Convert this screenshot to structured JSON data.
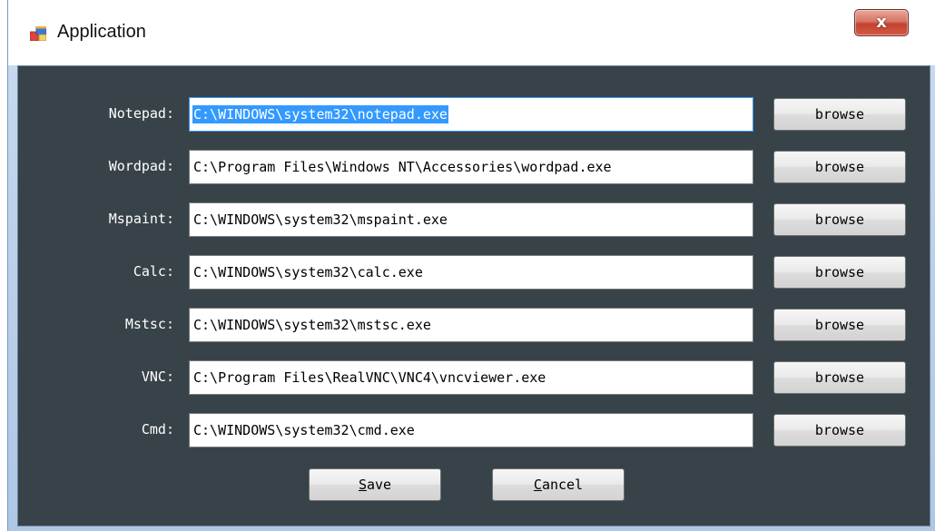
{
  "window": {
    "title": "Application",
    "close_label": "x"
  },
  "rows": [
    {
      "label": "Notepad:",
      "value": "C:\\WINDOWS\\system32\\notepad.exe",
      "browse_label": "browse",
      "selected": true
    },
    {
      "label": "Wordpad:",
      "value": "C:\\Program Files\\Windows NT\\Accessories\\wordpad.exe",
      "browse_label": "browse"
    },
    {
      "label": "Mspaint:",
      "value": "C:\\WINDOWS\\system32\\mspaint.exe",
      "browse_label": "browse"
    },
    {
      "label": "Calc:",
      "value": "C:\\WINDOWS\\system32\\calc.exe",
      "browse_label": "browse"
    },
    {
      "label": "Mstsc:",
      "value": "C:\\WINDOWS\\system32\\mstsc.exe",
      "browse_label": "browse"
    },
    {
      "label": "VNC:",
      "value": "C:\\Program Files\\RealVNC\\VNC4\\vncviewer.exe",
      "browse_label": "browse"
    },
    {
      "label": "Cmd:",
      "value": "C:\\WINDOWS\\system32\\cmd.exe",
      "browse_label": "browse"
    }
  ],
  "buttons": {
    "save": {
      "mnemonic": "S",
      "rest": "ave"
    },
    "cancel": {
      "mnemonic": "C",
      "rest": "ancel"
    }
  },
  "colors": {
    "client_background": "#384349",
    "selection": "#3399ff",
    "close_button": "#c2432f"
  },
  "icons": {
    "app": "application-window-icon",
    "close": "close-icon"
  }
}
